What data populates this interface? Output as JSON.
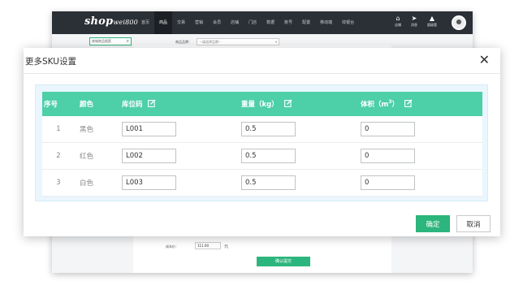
{
  "app": {
    "logo": "shop",
    "logo_sub": "wei800",
    "nav": [
      {
        "label": "首页"
      },
      {
        "label": "商品"
      },
      {
        "label": "交易"
      },
      {
        "label": "营销"
      },
      {
        "label": "会员"
      },
      {
        "label": "店铺"
      },
      {
        "label": "门店"
      },
      {
        "label": "数据"
      },
      {
        "label": "账号"
      },
      {
        "label": "配置"
      },
      {
        "label": "移动端"
      },
      {
        "label": "收银台"
      }
    ],
    "tools": [
      {
        "icon": "store-icon",
        "label": "店铺"
      },
      {
        "icon": "send-icon",
        "label": "消息"
      },
      {
        "icon": "user-icon",
        "label": "超级管"
      }
    ],
    "sidebar_search_placeholder": "商城商品搜索",
    "filter_label": "商品品牌：",
    "filter_placeholder": "--请选择品牌--",
    "cost_label": "成本价：",
    "cost_value": "111.00",
    "cost_unit": "元",
    "confirm_label": "确认提交"
  },
  "modal": {
    "title": "更多SKU设置",
    "columns": {
      "index": "序号",
      "color": "颜色",
      "sku_code": "库位码",
      "weight": "重量（kg）",
      "volume_prefix": "体积（m",
      "volume_sup": "3",
      "volume_suffix": "）"
    },
    "rows": [
      {
        "index": "1",
        "color": "黑色",
        "sku_code": "L001",
        "weight": "0.5",
        "volume": "0"
      },
      {
        "index": "2",
        "color": "红色",
        "sku_code": "L002",
        "weight": "0.5",
        "volume": "0"
      },
      {
        "index": "3",
        "color": "白色",
        "sku_code": "L003",
        "weight": "0.5",
        "volume": "0"
      }
    ],
    "ok_label": "确定",
    "cancel_label": "取消"
  },
  "colors": {
    "accent": "#2cb57c",
    "table_header": "#4dcfa8",
    "topbar": "#2b2f36"
  }
}
